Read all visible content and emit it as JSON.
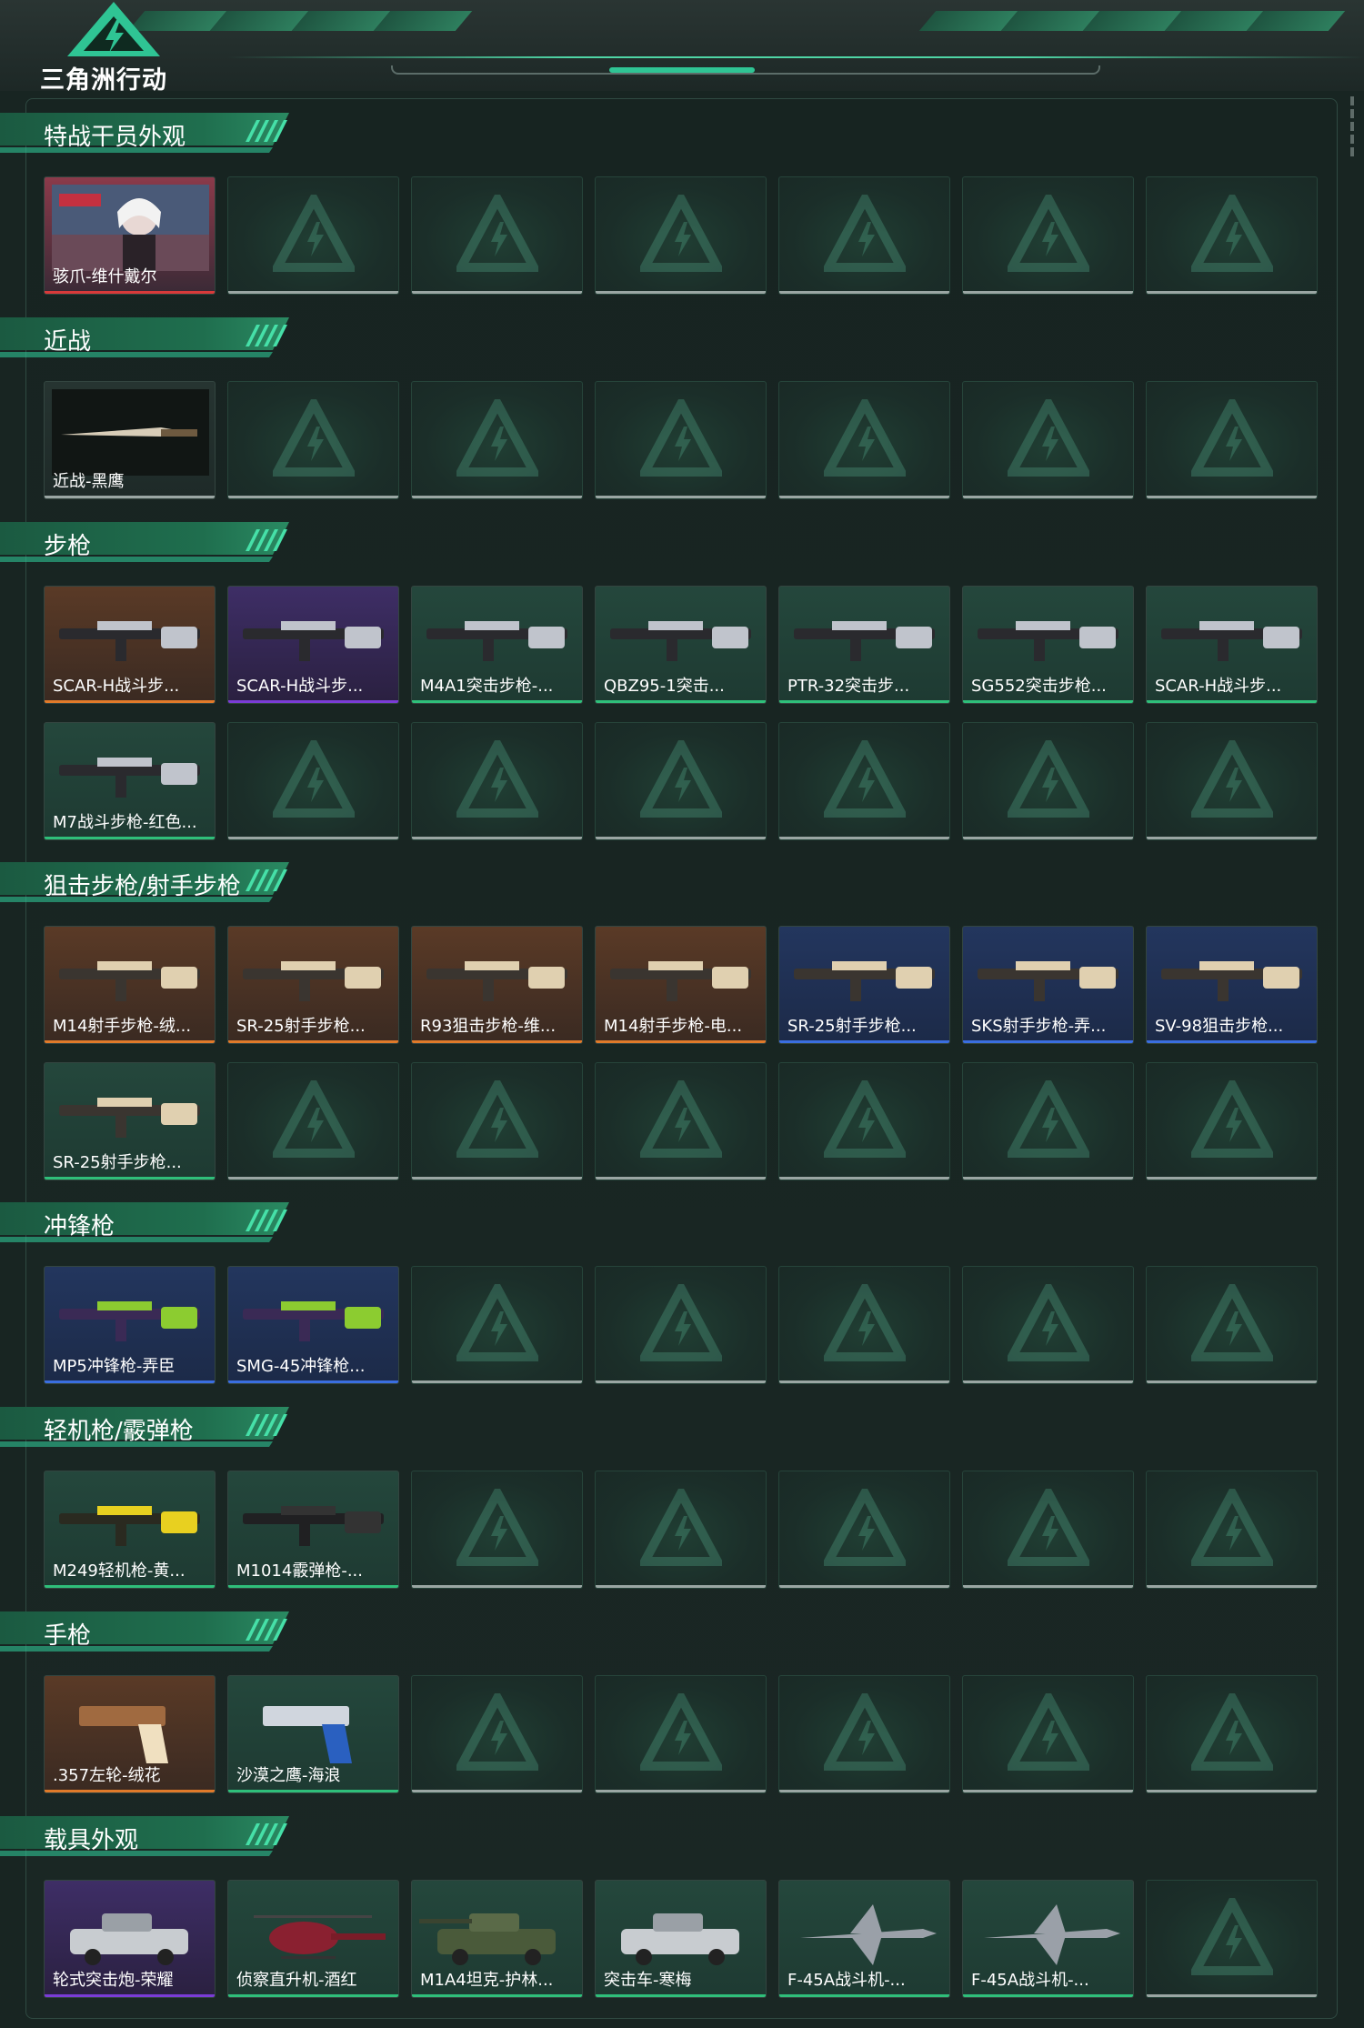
{
  "app": {
    "logo_text": "三角洲行动"
  },
  "sections": [
    {
      "title": "特战干员外观",
      "rows": [
        [
          {
            "label": "骇爪-维什戴尔",
            "rarity": "red",
            "icon": "operator-portrait"
          },
          null,
          null,
          null,
          null,
          null,
          null
        ]
      ]
    },
    {
      "title": "近战",
      "rows": [
        [
          {
            "label": "近战-黑鹰",
            "rarity": "grey",
            "icon": "knife"
          },
          null,
          null,
          null,
          null,
          null,
          null
        ]
      ]
    },
    {
      "title": "步枪",
      "rows": [
        [
          {
            "label": "SCAR-H战斗步...",
            "rarity": "orange",
            "icon": "rifle"
          },
          {
            "label": "SCAR-H战斗步...",
            "rarity": "purple",
            "icon": "rifle"
          },
          {
            "label": "M4A1突击步枪-...",
            "rarity": "green",
            "icon": "rifle"
          },
          {
            "label": "QBZ95-1突击...",
            "rarity": "green",
            "icon": "rifle"
          },
          {
            "label": "PTR-32突击步...",
            "rarity": "green",
            "icon": "rifle"
          },
          {
            "label": "SG552突击步枪...",
            "rarity": "green",
            "icon": "rifle"
          },
          {
            "label": "SCAR-H战斗步...",
            "rarity": "green",
            "icon": "rifle"
          }
        ],
        [
          {
            "label": "M7战斗步枪-红色...",
            "rarity": "green",
            "icon": "rifle"
          },
          null,
          null,
          null,
          null,
          null,
          null
        ]
      ]
    },
    {
      "title": "狙击步枪/射手步枪",
      "rows": [
        [
          {
            "label": "M14射手步枪-绒...",
            "rarity": "orange",
            "icon": "sniper"
          },
          {
            "label": "SR-25射手步枪...",
            "rarity": "orange",
            "icon": "sniper"
          },
          {
            "label": "R93狙击步枪-维...",
            "rarity": "orange",
            "icon": "sniper"
          },
          {
            "label": "M14射手步枪-电...",
            "rarity": "orange",
            "icon": "sniper"
          },
          {
            "label": "SR-25射手步枪...",
            "rarity": "blue",
            "icon": "sniper"
          },
          {
            "label": "SKS射手步枪-弄...",
            "rarity": "blue",
            "icon": "sniper"
          },
          {
            "label": "SV-98狙击步枪...",
            "rarity": "blue",
            "icon": "sniper"
          }
        ],
        [
          {
            "label": "SR-25射手步枪...",
            "rarity": "green",
            "icon": "sniper"
          },
          null,
          null,
          null,
          null,
          null,
          null
        ]
      ]
    },
    {
      "title": "冲锋枪",
      "rows": [
        [
          {
            "label": "MP5冲锋枪-弄臣",
            "rarity": "blue",
            "icon": "smg"
          },
          {
            "label": "SMG-45冲锋枪...",
            "rarity": "blue",
            "icon": "smg"
          },
          null,
          null,
          null,
          null,
          null
        ]
      ]
    },
    {
      "title": "轻机枪/霰弹枪",
      "rows": [
        [
          {
            "label": "M249轻机枪-黄...",
            "rarity": "green",
            "icon": "lmg"
          },
          {
            "label": "M1014霰弹枪-...",
            "rarity": "green",
            "icon": "shotgun"
          },
          null,
          null,
          null,
          null,
          null
        ]
      ]
    },
    {
      "title": "手枪",
      "rows": [
        [
          {
            "label": ".357左轮-绒花",
            "rarity": "orange",
            "icon": "revolver"
          },
          {
            "label": "沙漠之鹰-海浪",
            "rarity": "green",
            "icon": "pistol"
          },
          null,
          null,
          null,
          null,
          null
        ]
      ]
    },
    {
      "title": "载具外观",
      "rows": [
        [
          {
            "label": "轮式突击炮-荣耀",
            "rarity": "purple",
            "icon": "armored-car"
          },
          {
            "label": "侦察直升机-酒红",
            "rarity": "green",
            "icon": "helicopter"
          },
          {
            "label": "M1A4坦克-护林...",
            "rarity": "green",
            "icon": "tank"
          },
          {
            "label": "突击车-寒梅",
            "rarity": "green",
            "icon": "assault-car"
          },
          {
            "label": "F-45A战斗机-...",
            "rarity": "green",
            "icon": "jet"
          },
          {
            "label": "F-45A战斗机-...",
            "rarity": "green",
            "icon": "jet"
          },
          null
        ]
      ]
    }
  ],
  "colors": {
    "red": "#d93a3a",
    "orange": "#e07a2a",
    "purple": "#7a3cd6",
    "green": "#2fbf7a",
    "blue": "#3a6ee0",
    "grey": "#9aa6a3",
    "accent": "#2fc494"
  }
}
